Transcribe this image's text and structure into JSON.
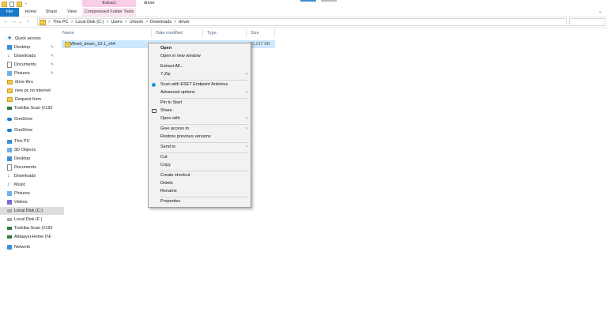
{
  "window": {
    "title": "driver",
    "contextual_tab_top": "Extract"
  },
  "ribbon": {
    "tabs": [
      "File",
      "Home",
      "Share",
      "View",
      "Compressed Folder Tools"
    ]
  },
  "address_bar": {
    "segments": [
      "This PC",
      "Local Disk (C:)",
      "Users",
      "Umesh",
      "Downloads",
      "driver"
    ]
  },
  "nav_pane": {
    "items": [
      {
        "label": "Quick access",
        "icon": "star-icon"
      },
      {
        "label": "Desktop",
        "icon": "desktop-icon",
        "pinned": true
      },
      {
        "label": "Downloads",
        "icon": "download-icon",
        "pinned": true
      },
      {
        "label": "Documents",
        "icon": "document-icon",
        "pinned": true
      },
      {
        "label": "Pictures",
        "icon": "picture-icon",
        "pinned": true
      },
      {
        "label": "drive thru",
        "icon": "folder-icon"
      },
      {
        "label": "new pc no internet",
        "icon": "folder-icon"
      },
      {
        "label": "Request form",
        "icon": "folder-icon"
      },
      {
        "label": "Toshiba Scan (\\\\192",
        "icon": "network-drive-icon"
      },
      {
        "label": "OneDrive",
        "icon": "cloud-icon"
      },
      {
        "label": "OneDrive",
        "icon": "cloud-icon"
      },
      {
        "label": "This PC",
        "icon": "pc-icon"
      },
      {
        "label": "3D Objects",
        "icon": "3d-objects-icon"
      },
      {
        "label": "Desktop",
        "icon": "desktop-icon"
      },
      {
        "label": "Documents",
        "icon": "document-icon"
      },
      {
        "label": "Downloads",
        "icon": "download-icon"
      },
      {
        "label": "Music",
        "icon": "music-icon"
      },
      {
        "label": "Pictures",
        "icon": "picture-icon"
      },
      {
        "label": "Videos",
        "icon": "video-icon"
      },
      {
        "label": "Local Disk (C:)",
        "icon": "disk-icon",
        "selected": true
      },
      {
        "label": "Local Disk (F:)",
        "icon": "disk-icon"
      },
      {
        "label": "Toshiba Scan (\\\\192",
        "icon": "network-drive-icon"
      },
      {
        "label": "Aldaaysi-Home (\\\\F",
        "icon": "network-drive-icon"
      },
      {
        "label": "Network",
        "icon": "network-icon"
      }
    ]
  },
  "columns": [
    "Name",
    "Date modified",
    "Type",
    "Size"
  ],
  "files": [
    {
      "name": "Wired_driver_10.1_x64",
      "size": "33,217 KB"
    }
  ],
  "context_menu": {
    "items": [
      {
        "label": "Open",
        "bold": true
      },
      {
        "label": "Open in new window"
      },
      {
        "label": "Extract All..."
      },
      {
        "label": "7-Zip",
        "submenu": true
      },
      {
        "label": "Scan with ESET Endpoint Antivirus",
        "icon": "eset-icon"
      },
      {
        "label": "Advanced options",
        "submenu": true
      },
      {
        "label": "Pin to Start"
      },
      {
        "label": "Share",
        "icon": "share-icon"
      },
      {
        "label": "Open with",
        "submenu": true
      },
      {
        "label": "Give access to",
        "submenu": true
      },
      {
        "label": "Restore previous versions"
      },
      {
        "label": "Send to",
        "submenu": true
      },
      {
        "label": "Cut"
      },
      {
        "label": "Copy"
      },
      {
        "label": "Create shortcut"
      },
      {
        "label": "Delete"
      },
      {
        "label": "Rename"
      },
      {
        "label": "Properties"
      }
    ]
  },
  "icons": {
    "back": "←",
    "forward": "→",
    "recent": "⌄",
    "up": "↑",
    "separator": ">",
    "submenu": "›",
    "pin": "✎",
    "expand": "›",
    "ribbon_expand": "⌄"
  }
}
